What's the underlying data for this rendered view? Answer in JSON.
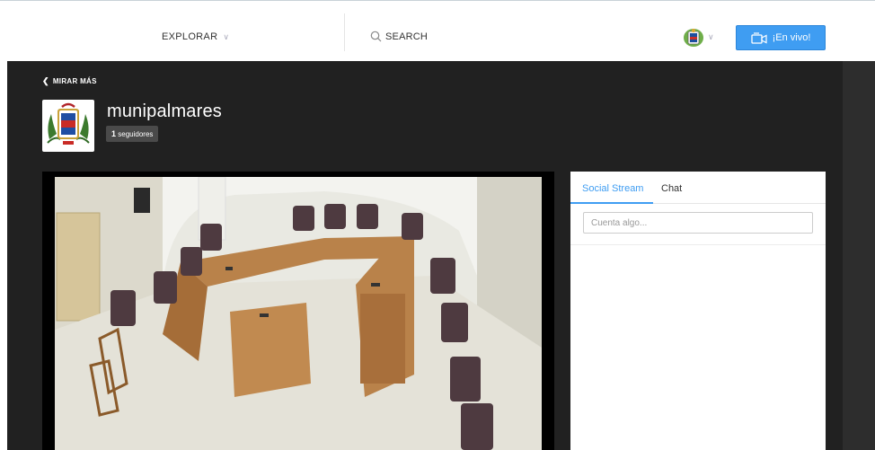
{
  "nav": {
    "explore_label": "EXPLORAR",
    "search_label": "SEARCH",
    "live_label": "¡En vivo!"
  },
  "channel": {
    "back_label": "MIRAR MÁS",
    "name": "munipalmares",
    "followers_count": "1",
    "followers_label": "seguidores"
  },
  "panel": {
    "tabs": [
      {
        "label": "Social Stream",
        "active": true
      },
      {
        "label": "Chat",
        "active": false
      }
    ],
    "input_placeholder": "Cuenta algo..."
  },
  "colors": {
    "accent": "#3f9df2",
    "dark_bg": "#212121"
  }
}
